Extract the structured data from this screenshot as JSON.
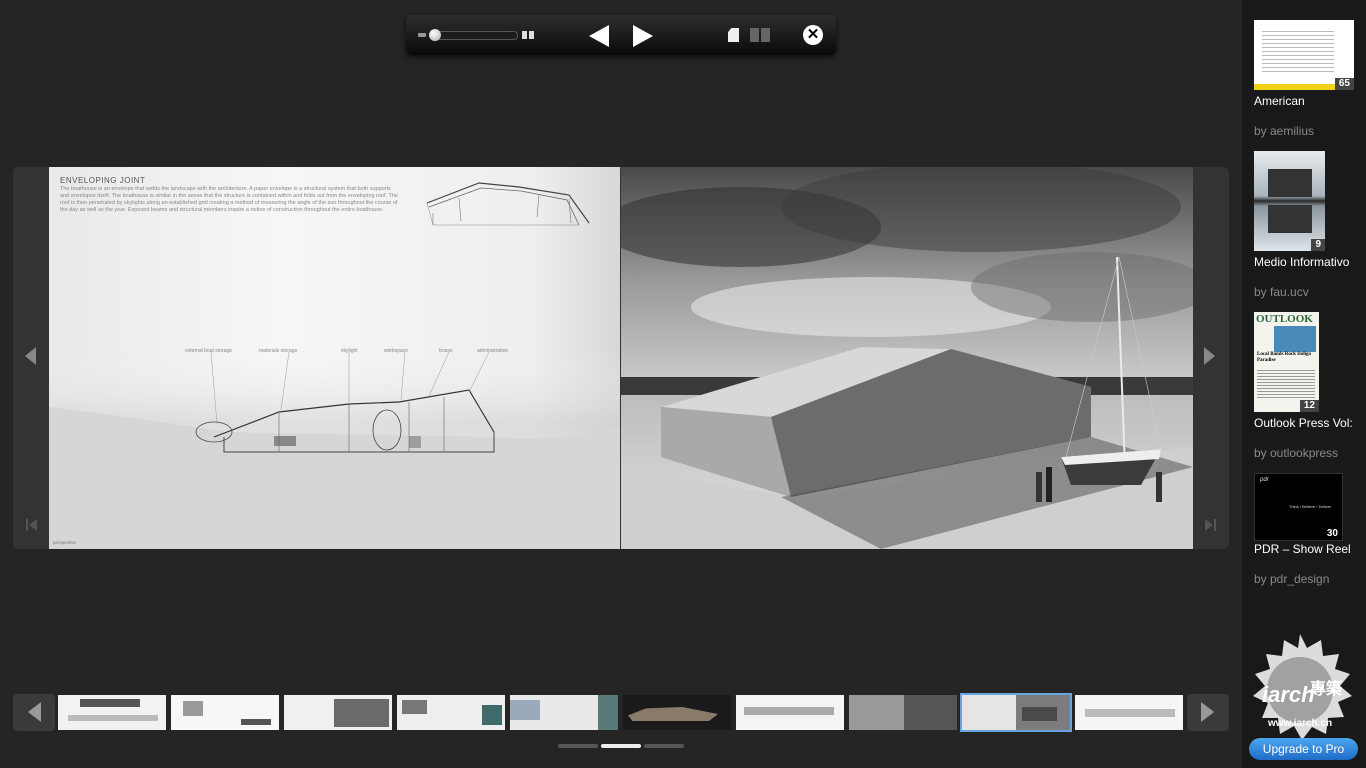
{
  "toolbar": {
    "icons": [
      "zoom-out-icon",
      "zoom-slider",
      "zoom-in-icon",
      "previous-icon",
      "next-icon",
      "single-page-icon",
      "double-page-icon",
      "close-icon"
    ],
    "close_glyph": "✕"
  },
  "spread": {
    "left_page": {
      "heading": "ENVELOPING JOINT",
      "body": "The boathouse is an envelope that welds the landscape with the architecture. A paper envelope is a structural system that both supports and envelopes itself. The boathouse is similar in the sense that the structure is contained within and folds out from the enveloping roof. The roof is then penetrated by skylights along an established grid creating a method of measuring the angle of the sun throughout the course of the day as well as the year. Exposed beams and structural members inspire a notion of construction throughout the entire boathouse.",
      "diagram_labels": [
        "external boat storage",
        "materials storage",
        "skylight",
        "workspace",
        "trusss",
        "administration"
      ],
      "caption": "perspective"
    }
  },
  "thumbnails": {
    "count": 10,
    "active_index": 8
  },
  "sidebar": {
    "publications": [
      {
        "title": "American",
        "author": "by aemilius",
        "pages": "65"
      },
      {
        "title": "Medio Informativo",
        "author": "by fau.ucv",
        "pages": "9"
      },
      {
        "title": "Outlook Press Vol:",
        "author": "by outlookpress",
        "pages": "12"
      },
      {
        "title": "PDR – Show Reel",
        "author": "by pdr_design",
        "pages": "30"
      }
    ],
    "cover_texts": {
      "outlook_masthead": "OUTLOOK",
      "outlook_headline": "Local Bands Rock Indigo Paradise",
      "pdr_logo": "pdr",
      "pdr_tagline": "Think / Believe / Deliver"
    }
  },
  "upgrade_label": "Upgrade to Pro",
  "watermark": {
    "logo_text": "iarch",
    "chinese_text": "專築",
    "url": "www.iarch.cn"
  },
  "colors": {
    "background": "#252525",
    "sidebar": "#191919",
    "upgrade_button": "#2a80d8",
    "active_thumb_outline": "#6aa4e0"
  }
}
